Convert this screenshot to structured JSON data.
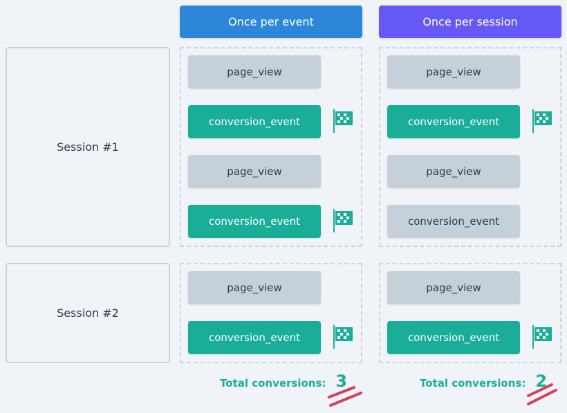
{
  "headers": {
    "once_per_event": "Once per event",
    "once_per_session": "Once per session"
  },
  "colors": {
    "event_header": "#2d87d8",
    "session_header": "#6658f4",
    "conversion": "#1aae99",
    "neutral_event": "#c5d0d9",
    "strike": "#d6405b"
  },
  "sessions": [
    {
      "label": "Session #1"
    },
    {
      "label": "Session #2"
    }
  ],
  "once_per_event": {
    "session1": [
      {
        "name": "page_view",
        "counted": false
      },
      {
        "name": "conversion_event",
        "counted": true
      },
      {
        "name": "page_view",
        "counted": false
      },
      {
        "name": "conversion_event",
        "counted": true
      }
    ],
    "session2": [
      {
        "name": "page_view",
        "counted": false
      },
      {
        "name": "conversion_event",
        "counted": true
      }
    ],
    "total_label": "Total conversions:",
    "total": "3"
  },
  "once_per_session": {
    "session1": [
      {
        "name": "page_view",
        "counted": false
      },
      {
        "name": "conversion_event",
        "counted": true
      },
      {
        "name": "page_view",
        "counted": false
      },
      {
        "name": "conversion_event",
        "counted": false
      }
    ],
    "session2": [
      {
        "name": "page_view",
        "counted": false
      },
      {
        "name": "conversion_event",
        "counted": true
      }
    ],
    "total_label": "Total conversions:",
    "total": "2"
  }
}
